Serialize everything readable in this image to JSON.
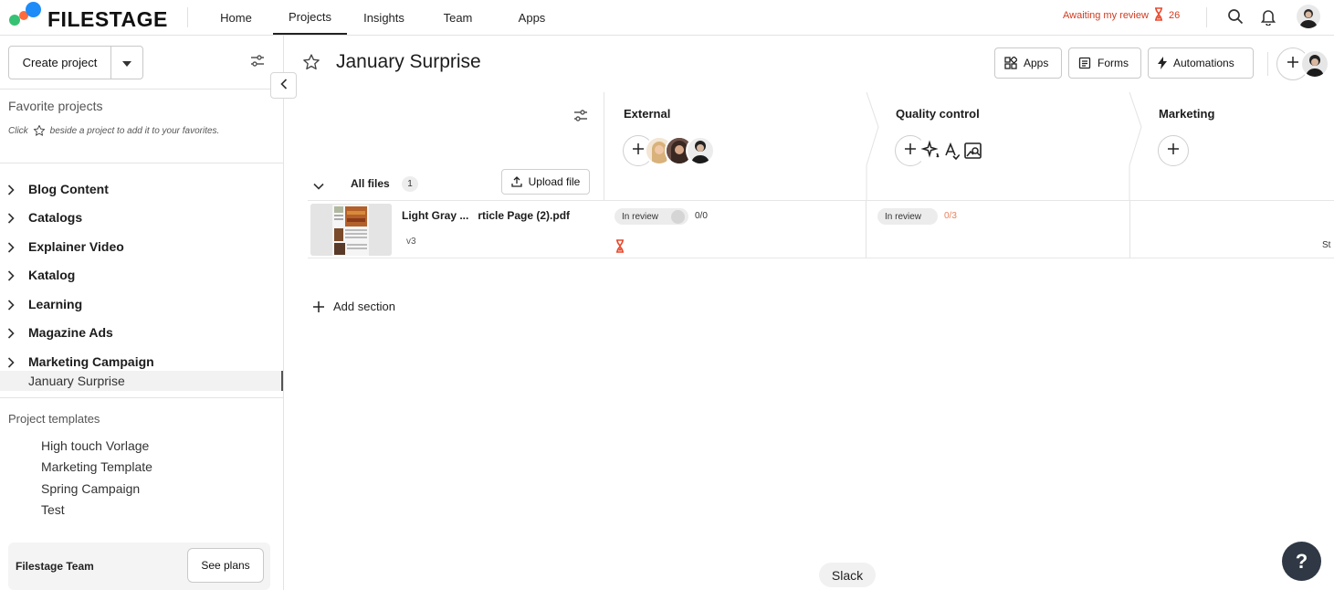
{
  "brand": {
    "name": "FILESTAGE"
  },
  "nav": {
    "items": [
      {
        "label": "Home"
      },
      {
        "label": "Projects"
      },
      {
        "label": "Insights"
      },
      {
        "label": "Team"
      },
      {
        "label": "Apps"
      }
    ],
    "active": "Projects"
  },
  "awaiting": {
    "label": "Awaiting my review",
    "count": "26"
  },
  "sidebar": {
    "create_label": "Create project",
    "favorites_title": "Favorite projects",
    "favorites_hint_before": "Click",
    "favorites_hint_after": "beside a project to add it to your favorites.",
    "projects": [
      "Blog Content",
      "Catalogs",
      "Explainer Video",
      "Katalog",
      "Learning",
      "Magazine Ads",
      "Marketing Campaign"
    ],
    "active_project": "January Surprise",
    "templates_title": "Project templates",
    "templates": [
      "High touch Vorlage",
      "Marketing Template",
      "Spring Campaign",
      "Test"
    ],
    "team_name": "Filestage Team",
    "see_plans_label": "See plans"
  },
  "main": {
    "title": "January Surprise",
    "buttons": {
      "apps": "Apps",
      "forms": "Forms",
      "automations": "Automations"
    },
    "columns": [
      {
        "name": "External"
      },
      {
        "name": "Quality control"
      },
      {
        "name": "Marketing"
      }
    ],
    "section": {
      "label": "All files",
      "count": "1",
      "upload_label": "Upload file"
    },
    "file": {
      "name": "Light Gray ...   rticle Page (2).pdf",
      "version": "v3",
      "external_status": "In review",
      "external_ratio": "0/0",
      "qc_status": "In review",
      "qc_ratio": "0/3",
      "cut_text": "St"
    },
    "add_section_label": "Add section"
  },
  "tooltip": {
    "label": "Slack"
  },
  "help": {
    "label": "?"
  },
  "colors": {
    "accent_red": "#d13b1f",
    "help_bg": "#2f3844",
    "ratio_orange": "#e8835c"
  }
}
